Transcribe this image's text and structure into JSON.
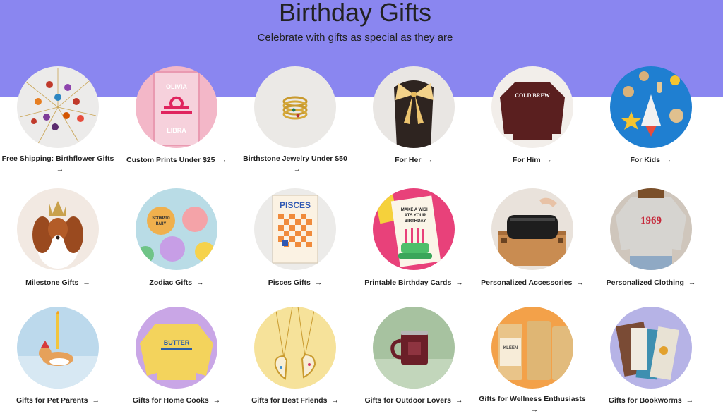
{
  "header": {
    "title": "Birthday Gifts",
    "subtitle": "Celebrate with gifts as special as they are",
    "band_color": "#8a86f0"
  },
  "arrow_glyph": "→",
  "categories": [
    {
      "label": "Free Shipping: Birthflower Gifts",
      "image": "birthflower-necklaces"
    },
    {
      "label": "Custom Prints Under $25",
      "image": "libra-print"
    },
    {
      "label": "Birthstone Jewelry Under $50",
      "image": "stacked-rings"
    },
    {
      "label": "For Her",
      "image": "hair-bow"
    },
    {
      "label": "For Him",
      "image": "cold-brew-sweatshirt"
    },
    {
      "label": "For Kids",
      "image": "wooden-space-toys"
    },
    {
      "label": "Milestone Gifts",
      "image": "dog-with-crown"
    },
    {
      "label": "Zodiac Gifts",
      "image": "zodiac-flower-patches"
    },
    {
      "label": "Pisces Gifts",
      "image": "pisces-card"
    },
    {
      "label": "Printable Birthday Cards",
      "image": "birthday-card"
    },
    {
      "label": "Personalized Accessories",
      "image": "leather-dopp-kit"
    },
    {
      "label": "Personalized Clothing",
      "image": "1969-sweatshirt"
    },
    {
      "label": "Gifts for Pet Parents",
      "image": "corgi-candle"
    },
    {
      "label": "Gifts for Home Cooks",
      "image": "butter-sweatshirt"
    },
    {
      "label": "Gifts for Best Friends",
      "image": "heart-necklaces"
    },
    {
      "label": "Gifts for Outdoor Lovers",
      "image": "enamel-mug"
    },
    {
      "label": "Gifts for Wellness Enthusiasts",
      "image": "soap-bars"
    },
    {
      "label": "Gifts for Bookworms",
      "image": "books"
    }
  ],
  "image_text": {
    "olivia": "OLIVIA",
    "libra": "LIBRA",
    "cold_brew": "COLD BREW",
    "zodiac_1": "SCORPIO",
    "zodiac_2": "BABY",
    "pisces": "PISCES",
    "card_line1": "MAKE A WISH",
    "card_line2": "ATS YOUR",
    "card_line3": "BIRTHDAY",
    "year": "1969",
    "butter": "BUTTER",
    "kleen": "KLEEN"
  }
}
